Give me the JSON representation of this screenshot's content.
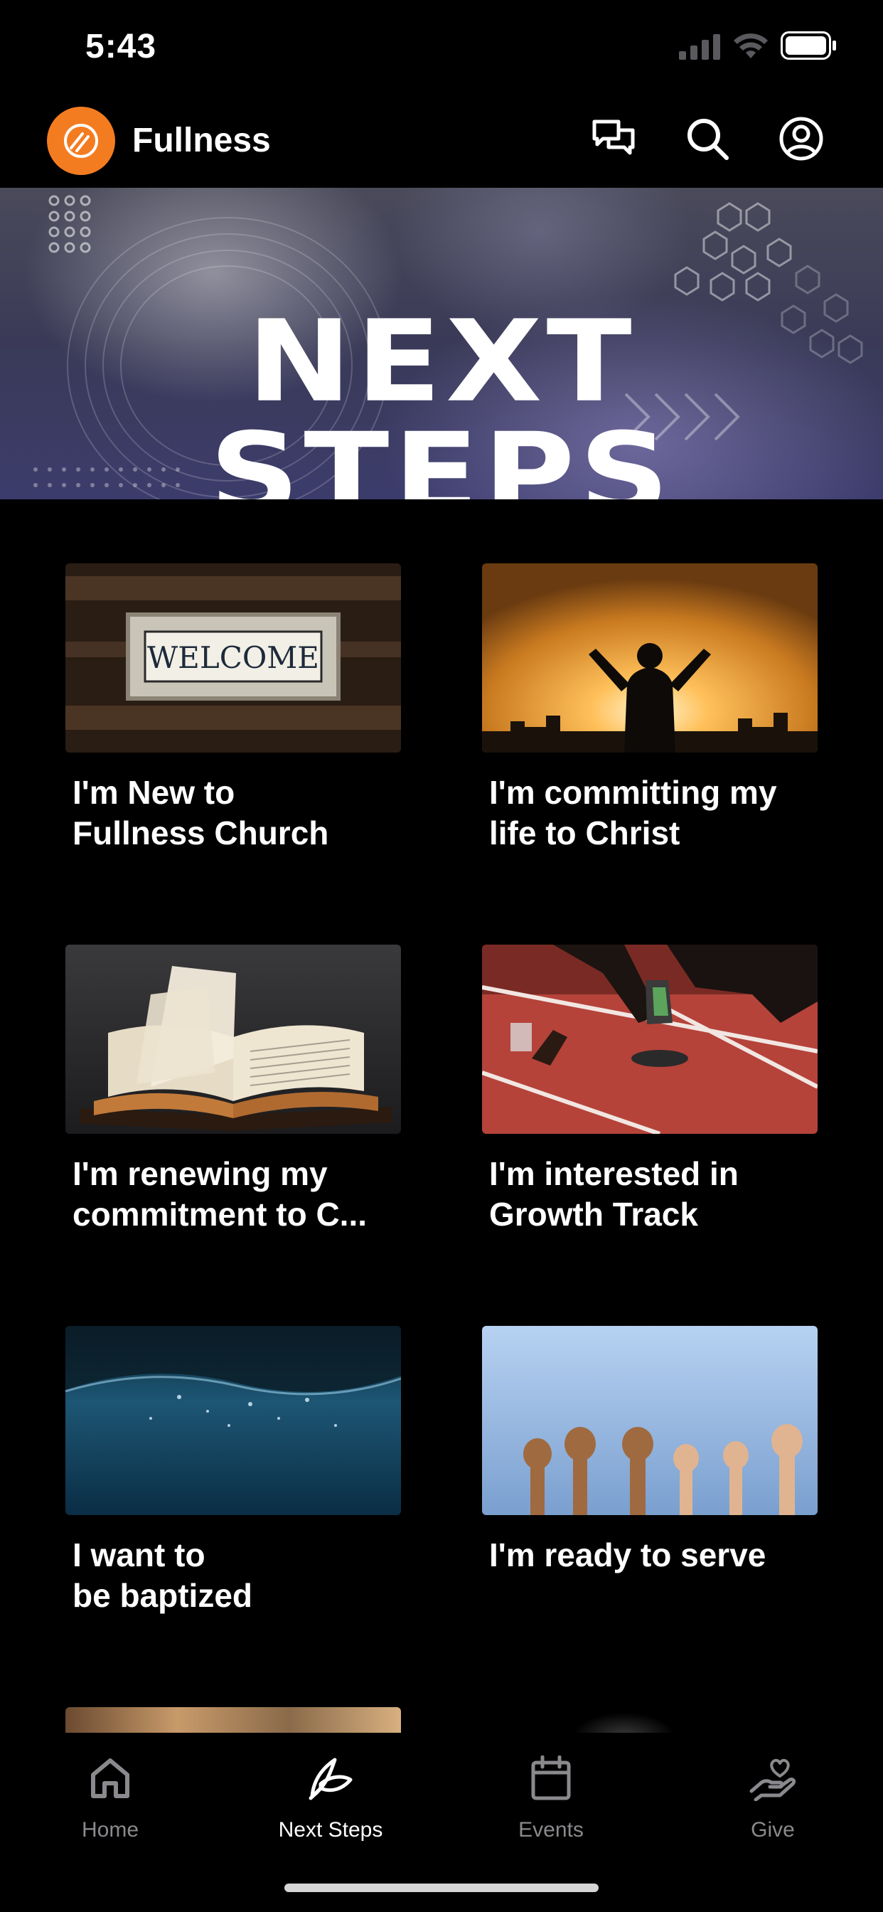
{
  "status_bar": {
    "time": "5:43"
  },
  "app": {
    "name": "Fullness"
  },
  "header_icons": [
    "chat-icon",
    "search-icon",
    "profile-icon"
  ],
  "hero": {
    "title": "NEXT STEPS"
  },
  "cards": [
    {
      "label": "I'm New to\nFullness Church",
      "image": "welcome-sign"
    },
    {
      "label": "I'm committing my\nlife to Christ",
      "image": "man-arms-raised-sunset"
    },
    {
      "label": "I'm renewing my\ncommitment to C...",
      "image": "open-bible"
    },
    {
      "label": "I'm interested in\nGrowth Track",
      "image": "runner-on-track"
    },
    {
      "label": "I want to\nbe baptized",
      "image": "water-surface"
    },
    {
      "label": "I'm ready to serve",
      "image": "raised-hands"
    }
  ],
  "tabs": [
    {
      "label": "Home",
      "icon": "home-icon",
      "active": false
    },
    {
      "label": "Next Steps",
      "icon": "leaf-icon",
      "active": true
    },
    {
      "label": "Events",
      "icon": "calendar-icon",
      "active": false
    },
    {
      "label": "Give",
      "icon": "heart-hand-icon",
      "active": false
    }
  ],
  "colors": {
    "accent": "#f47c20",
    "background": "#000000",
    "inactive_tab": "#8a8a8e"
  }
}
